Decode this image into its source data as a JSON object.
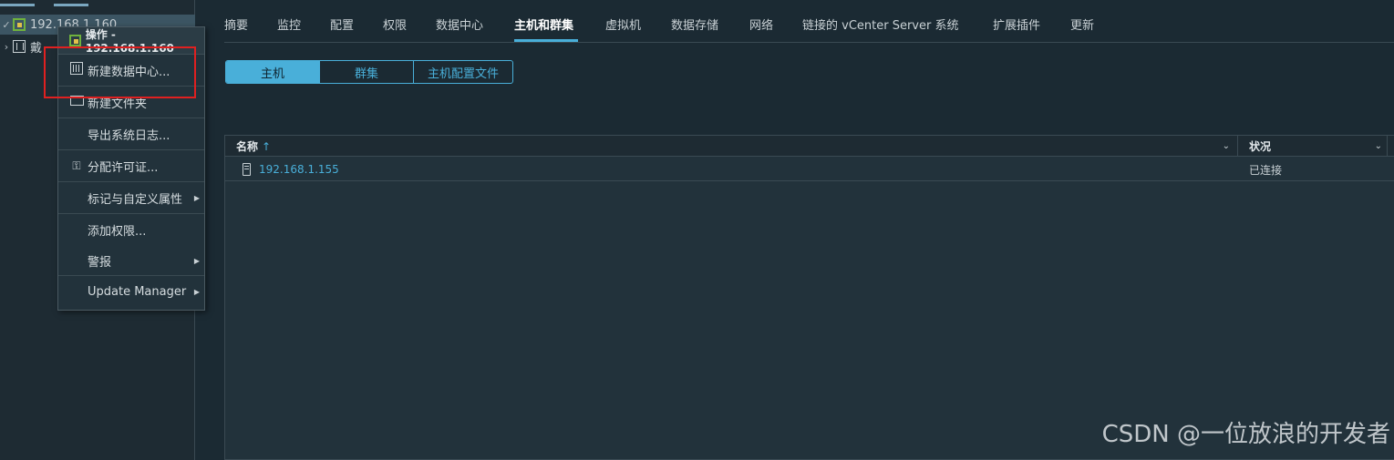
{
  "navigator": {
    "tree": [
      {
        "label": "192.168.1.160",
        "selected": true,
        "icon": "vcenter-icon"
      },
      {
        "label": "戴",
        "icon": "datacenter-icon"
      }
    ]
  },
  "context_menu": {
    "header": "操作 - 192.168.1.160",
    "items": [
      {
        "label": "新建数据中心...",
        "icon": "datacenter-icon",
        "highlighted": true
      },
      {
        "label": "新建文件夹",
        "icon": "folder-icon"
      },
      {
        "label": "导出系统日志..."
      },
      {
        "label": "分配许可证...",
        "icon": "license-key-icon"
      },
      {
        "label": "标记与自定义属性",
        "submenu": true
      },
      {
        "label": "添加权限..."
      },
      {
        "label": "警报",
        "submenu": true
      },
      {
        "label": "Update Manager",
        "submenu": true
      }
    ]
  },
  "tabs": [
    "摘要",
    "监控",
    "配置",
    "权限",
    "数据中心",
    "主机和群集",
    "虚拟机",
    "数据存储",
    "网络",
    "链接的 vCenter Server 系统",
    "扩展插件",
    "更新"
  ],
  "active_tab": "主机和群集",
  "segments": [
    "主机",
    "群集",
    "主机配置文件"
  ],
  "active_segment": "主机",
  "grid": {
    "columns": [
      {
        "label": "名称",
        "sort": "↑"
      },
      {
        "label": "状况"
      }
    ],
    "rows": [
      {
        "name": "192.168.1.155",
        "status": "已连接"
      }
    ]
  },
  "watermark": "CSDN @一位放浪的开发者",
  "colors": {
    "accent": "#49afd9",
    "highlight_box": "#e02020",
    "vcenter_green": "#6fb23d"
  }
}
